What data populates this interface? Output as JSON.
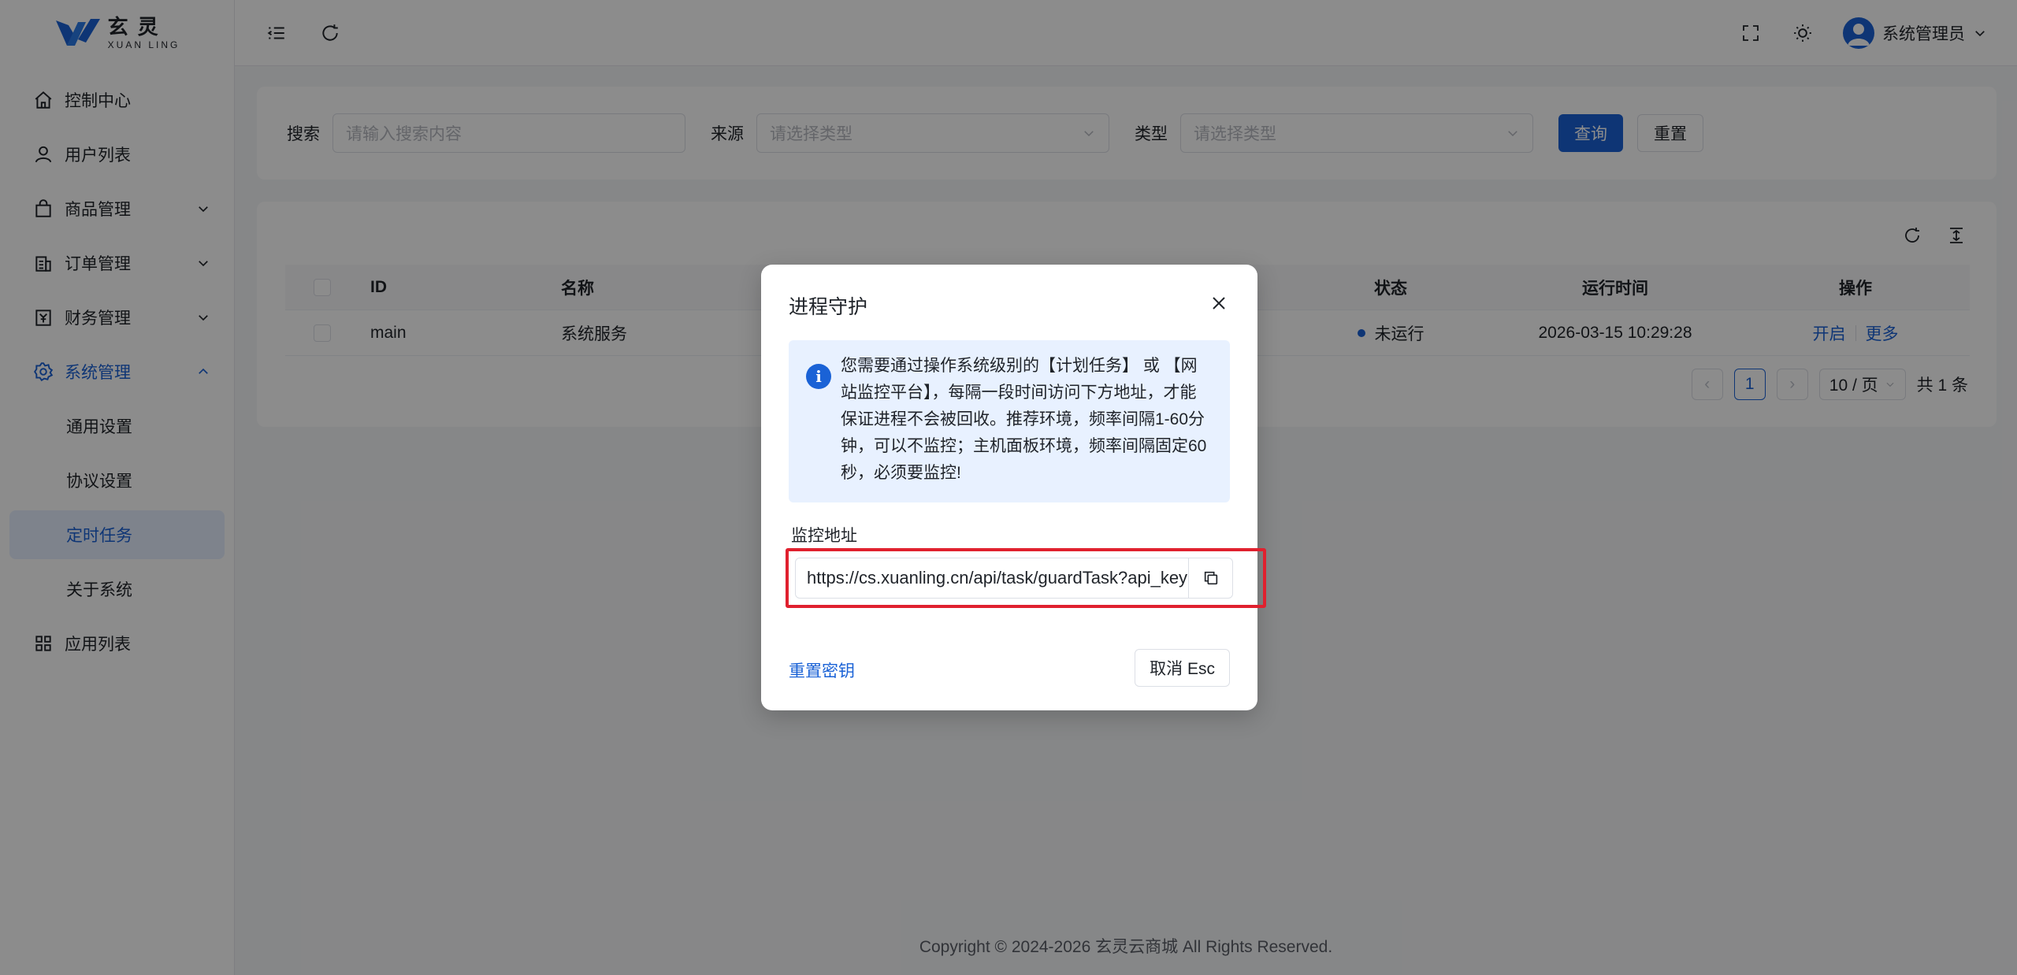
{
  "brand": {
    "logo_cn": "玄灵",
    "logo_en": "XUAN LING"
  },
  "sidebar": {
    "items": [
      {
        "label": "控制中心",
        "icon": "home-icon"
      },
      {
        "label": "用户列表",
        "icon": "user-icon"
      },
      {
        "label": "商品管理",
        "icon": "bag-icon"
      },
      {
        "label": "订单管理",
        "icon": "order-icon"
      },
      {
        "label": "财务管理",
        "icon": "finance-icon"
      },
      {
        "label": "系统管理",
        "icon": "gear-icon"
      },
      {
        "label": "通用设置"
      },
      {
        "label": "协议设置"
      },
      {
        "label": "定时任务"
      },
      {
        "label": "关于系统"
      },
      {
        "label": "应用列表",
        "icon": "grid-icon"
      }
    ]
  },
  "header": {
    "user_name": "系统管理员"
  },
  "search": {
    "keyword_label": "搜索",
    "keyword_placeholder": "请输入搜索内容",
    "source_label": "来源",
    "source_placeholder": "请选择类型",
    "type_label": "类型",
    "type_placeholder": "请选择类型",
    "query_button": "查询",
    "reset_button": "重置"
  },
  "table": {
    "columns": {
      "id": "ID",
      "name": "名称",
      "status": "状态",
      "time": "运行时间",
      "ops": "操作"
    },
    "rows": [
      {
        "id": "main",
        "name": "系统服务",
        "status": "未运行",
        "time": "2026-03-15 10:29:28",
        "op_start": "开启",
        "op_more": "更多"
      }
    ]
  },
  "pagination": {
    "prev": "‹",
    "current": "1",
    "next": "›",
    "page_size": "10 / 页",
    "total": "共 1 条"
  },
  "footer": {
    "copyright": "Copyright © 2024-2026 玄灵云商城 All Rights Reserved."
  },
  "dialog": {
    "title": "进程守护",
    "notice": "您需要通过操作系统级别的【计划任务】 或 【网站监控平台】，每隔一段时间访问下方地址，才能保证进程不会被回收。推荐环境，频率间隔1-60分钟，可以不监控；主机面板环境，频率间隔固定60秒，必须要监控!",
    "url_label": "监控地址",
    "url_value": "https://cs.xuanling.cn/api/task/guardTask?api_key=",
    "reset_key": "重置密钥",
    "cancel": "取消 Esc"
  },
  "colors": {
    "primary": "#1a62d6",
    "highlight_border": "#e0202e",
    "overlay": "rgba(0,0,0,0.45)"
  }
}
